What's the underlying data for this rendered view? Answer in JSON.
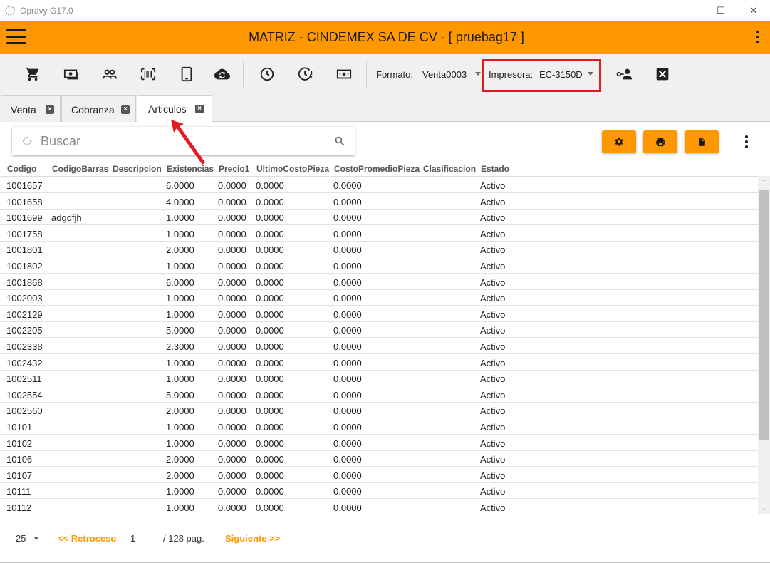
{
  "window": {
    "title": "Opravy G17.0",
    "minimize": "—",
    "maximize": "☐",
    "close": "✕"
  },
  "header": {
    "title": "MATRIZ - CINDEMEX SA DE CV - [ pruebag17 ]"
  },
  "colors": {
    "accent": "#ff9800",
    "highlight": "#e11b22"
  },
  "toolbar": {
    "icons": [
      "cart-icon",
      "cash-icon",
      "people-icon",
      "barcode-icon",
      "tablet-icon",
      "cloud-sync-icon",
      "clock-icon",
      "clock-alert-icon",
      "money-icon",
      "person-key-icon",
      "close-box-icon"
    ],
    "formato_label": "Formato:",
    "formato_value": "Venta0003",
    "impresora_label": "Impresora:",
    "impresora_value": "EC-3150D"
  },
  "tabs": [
    {
      "label": "Venta"
    },
    {
      "label": "Cobranza"
    },
    {
      "label": "Articulos",
      "active": true
    }
  ],
  "search": {
    "placeholder": "Buscar"
  },
  "table": {
    "columns": [
      "Codigo",
      "CodigoBarras",
      "Descripcion",
      "Existencias",
      "Precio1",
      "UltimoCostoPieza",
      "CostoPromedioPieza",
      "Clasificacion",
      "Estado"
    ],
    "rows": [
      [
        "1001657",
        "",
        "",
        "6.0000",
        "0.0000",
        "0.0000",
        "0.0000",
        "",
        "Activo"
      ],
      [
        "1001658",
        "",
        "",
        "4.0000",
        "0.0000",
        "0.0000",
        "0.0000",
        "",
        "Activo"
      ],
      [
        "1001699",
        "adgdfjh",
        "",
        "1.0000",
        "0.0000",
        "0.0000",
        "0.0000",
        "",
        "Activo"
      ],
      [
        "1001758",
        "",
        "",
        "1.0000",
        "0.0000",
        "0.0000",
        "0.0000",
        "",
        "Activo"
      ],
      [
        "1001801",
        "",
        "",
        "2.0000",
        "0.0000",
        "0.0000",
        "0.0000",
        "",
        "Activo"
      ],
      [
        "1001802",
        "",
        "",
        "1.0000",
        "0.0000",
        "0.0000",
        "0.0000",
        "",
        "Activo"
      ],
      [
        "1001868",
        "",
        "",
        "6.0000",
        "0.0000",
        "0.0000",
        "0.0000",
        "",
        "Activo"
      ],
      [
        "1002003",
        "",
        "",
        "1.0000",
        "0.0000",
        "0.0000",
        "0.0000",
        "",
        "Activo"
      ],
      [
        "1002129",
        "",
        "",
        "1.0000",
        "0.0000",
        "0.0000",
        "0.0000",
        "",
        "Activo"
      ],
      [
        "1002205",
        "",
        "",
        "5.0000",
        "0.0000",
        "0.0000",
        "0.0000",
        "",
        "Activo"
      ],
      [
        "1002338",
        "",
        "",
        "2.3000",
        "0.0000",
        "0.0000",
        "0.0000",
        "",
        "Activo"
      ],
      [
        "1002432",
        "",
        "",
        "1.0000",
        "0.0000",
        "0.0000",
        "0.0000",
        "",
        "Activo"
      ],
      [
        "1002511",
        "",
        "",
        "1.0000",
        "0.0000",
        "0.0000",
        "0.0000",
        "",
        "Activo"
      ],
      [
        "1002554",
        "",
        "",
        "5.0000",
        "0.0000",
        "0.0000",
        "0.0000",
        "",
        "Activo"
      ],
      [
        "1002560",
        "",
        "",
        "2.0000",
        "0.0000",
        "0.0000",
        "0.0000",
        "",
        "Activo"
      ],
      [
        "10101",
        "",
        "",
        "1.0000",
        "0.0000",
        "0.0000",
        "0.0000",
        "",
        "Activo"
      ],
      [
        "10102",
        "",
        "",
        "1.0000",
        "0.0000",
        "0.0000",
        "0.0000",
        "",
        "Activo"
      ],
      [
        "10106",
        "",
        "",
        "2.0000",
        "0.0000",
        "0.0000",
        "0.0000",
        "",
        "Activo"
      ],
      [
        "10107",
        "",
        "",
        "2.0000",
        "0.0000",
        "0.0000",
        "0.0000",
        "",
        "Activo"
      ],
      [
        "10111",
        "",
        "",
        "1.0000",
        "0.0000",
        "0.0000",
        "0.0000",
        "",
        "Activo"
      ],
      [
        "10112",
        "",
        "",
        "1.0000",
        "0.0000",
        "0.0000",
        "0.0000",
        "",
        "Activo"
      ]
    ]
  },
  "pager": {
    "page_size": "25",
    "prev_label": "<<  Retroceso",
    "page_value": "1",
    "total_label": "/  128  pag.",
    "next_label": "Siguiente  >>"
  }
}
